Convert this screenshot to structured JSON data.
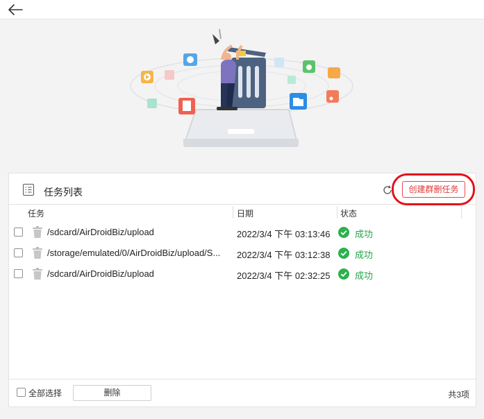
{
  "panel": {
    "title": "任务列表",
    "batch_button_label": "创建群删任务"
  },
  "table": {
    "headers": {
      "task": "任务",
      "date": "日期",
      "status": "状态"
    },
    "rows": [
      {
        "path": "/sdcard/AirDroidBiz/upload",
        "date": "2022/3/4 下午 03:13:46",
        "status": "成功"
      },
      {
        "path": "/storage/emulated/0/AirDroidBiz/upload/S...",
        "date": "2022/3/4 下午 03:12:38",
        "status": "成功"
      },
      {
        "path": "/sdcard/AirDroidBiz/upload",
        "date": "2022/3/4 下午 02:32:25",
        "status": "成功"
      }
    ]
  },
  "footer": {
    "select_all_label": "全部选择",
    "delete_label": "删除",
    "count_label": "共3项"
  },
  "colors": {
    "accent_red": "#e03a3a",
    "success_green": "#23a548",
    "highlight_ring": "#e3101b"
  },
  "icons": [
    "back-arrow-icon",
    "list-icon",
    "refresh-icon",
    "trash-icon",
    "success-check-icon"
  ]
}
